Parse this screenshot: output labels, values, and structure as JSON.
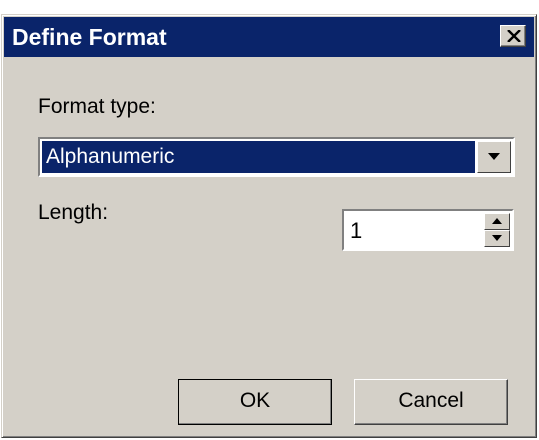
{
  "window": {
    "title": "Define Format"
  },
  "format_type": {
    "label": "Format type:",
    "selected": "Alphanumeric"
  },
  "length": {
    "label": "Length:",
    "value": "1"
  },
  "buttons": {
    "ok_label": "OK",
    "cancel_label": "Cancel"
  },
  "icons": {
    "close": "close-icon",
    "dropdown": "chevron-down-icon",
    "spin_up": "arrow-up-icon",
    "spin_down": "arrow-down-icon"
  },
  "colors": {
    "titlebar": "#0a246a",
    "face": "#d4d0c8",
    "selection": "#0a246a"
  }
}
